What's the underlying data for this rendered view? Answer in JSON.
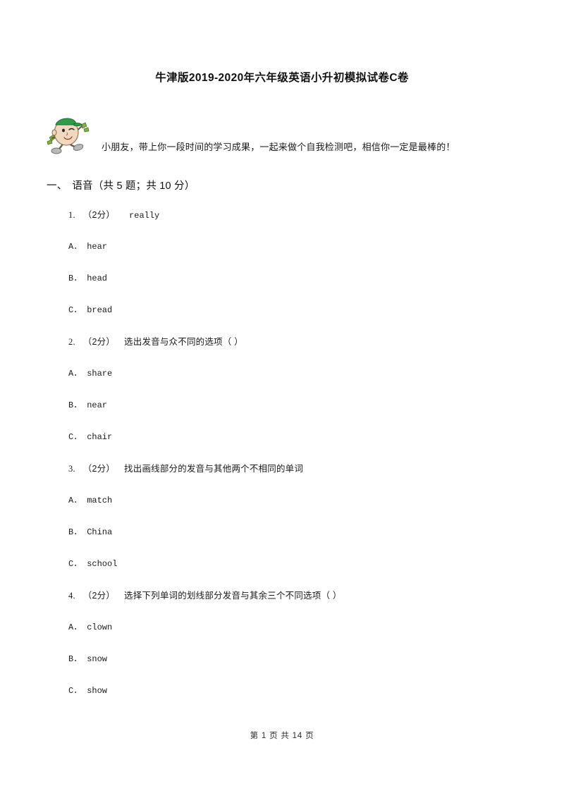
{
  "document": {
    "title": "牛津版2019-2020年六年级英语小升初模拟试卷C卷",
    "intro_text": "小朋友，带上你一段时间的学习成果，一起来做个自我检测吧，相信你一定是最棒的！",
    "mascot_icon": "cartoon-boy-icon"
  },
  "section": {
    "number": "一、",
    "name": "语音",
    "meta": "（共 5 题；共 10 分）"
  },
  "questions": [
    {
      "number": "1.",
      "score": "（2分）",
      "stem": "really",
      "stem_style": "mono",
      "options": [
        {
          "label": "A．",
          "text": "hear"
        },
        {
          "label": "B．",
          "text": "head"
        },
        {
          "label": "C．",
          "text": "bread"
        }
      ]
    },
    {
      "number": "2.",
      "score": "（2分）",
      "stem": "选出发音与众不同的选项（      ）",
      "stem_style": "cjk",
      "options": [
        {
          "label": "A．",
          "text": "share"
        },
        {
          "label": "B．",
          "text": "near"
        },
        {
          "label": "C．",
          "text": "chair"
        }
      ]
    },
    {
      "number": "3.",
      "score": "（2分）",
      "stem": "找出画线部分的发音与其他两个不相同的单词",
      "stem_style": "cjk",
      "options": [
        {
          "label": "A．",
          "text": "match"
        },
        {
          "label": "B．",
          "text": "China"
        },
        {
          "label": "C．",
          "text": "school"
        }
      ]
    },
    {
      "number": "4.",
      "score": "（2分）",
      "stem": "选择下列单词的划线部分发音与其余三个不同选项（      ）",
      "stem_style": "cjk",
      "options": [
        {
          "label": "A．",
          "text": "clown"
        },
        {
          "label": "B．",
          "text": "snow"
        },
        {
          "label": "C．",
          "text": "show"
        }
      ]
    }
  ],
  "footer": {
    "text": "第 1 页 共 14 页"
  }
}
